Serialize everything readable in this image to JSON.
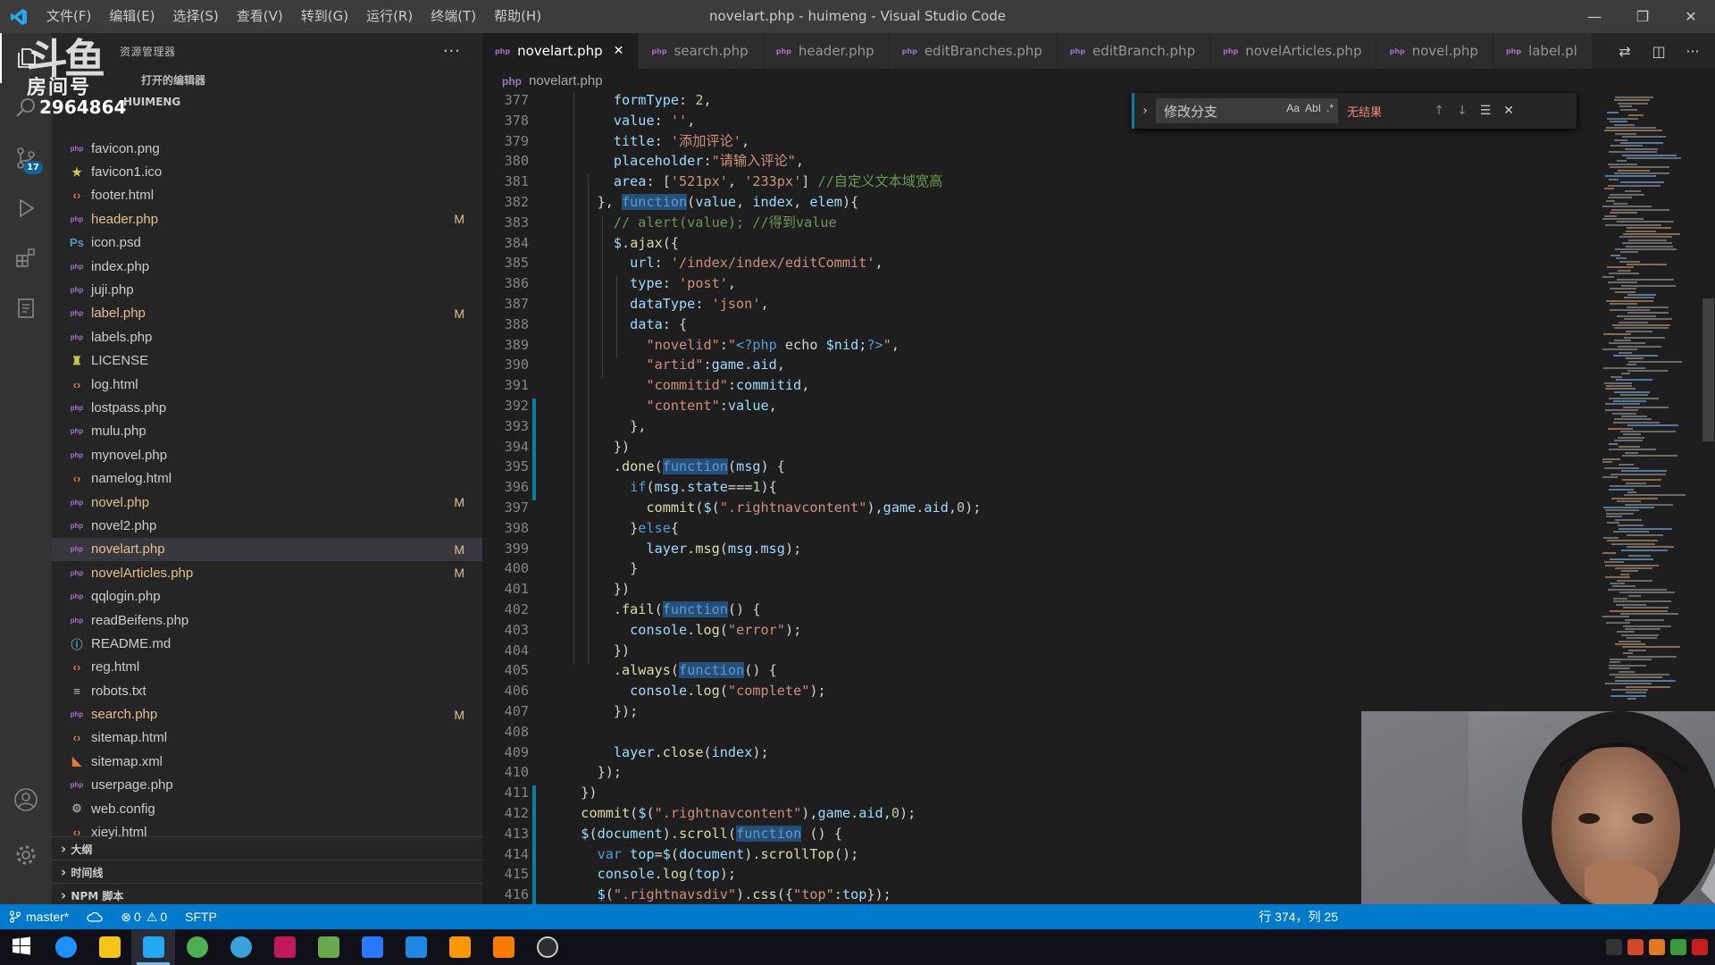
{
  "window": {
    "title": "novelart.php - huimeng - Visual Studio Code",
    "menu": [
      "文件(F)",
      "编辑(E)",
      "选择(S)",
      "查看(V)",
      "转到(G)",
      "运行(R)",
      "终端(T)",
      "帮助(H)"
    ],
    "controls": {
      "minimize": "—",
      "restore": "❐",
      "close": "✕"
    }
  },
  "watermark": {
    "logo": "斗鱼",
    "room": "房间号",
    "number": "2964864"
  },
  "activity_bar": {
    "scm_badge": "17"
  },
  "sidebar": {
    "title": "资源管理器",
    "more": "···",
    "open_editors": "打开的编辑器",
    "folder": "HUIMENG",
    "files": [
      {
        "name": "favicon.png",
        "type": "php",
        "modified": ""
      },
      {
        "name": "favicon1.ico",
        "type": "ico",
        "modified": ""
      },
      {
        "name": "footer.html",
        "type": "html",
        "modified": ""
      },
      {
        "name": "header.php",
        "type": "php",
        "modified": "M"
      },
      {
        "name": "icon.psd",
        "type": "psd",
        "modified": ""
      },
      {
        "name": "index.php",
        "type": "php",
        "modified": ""
      },
      {
        "name": "juji.php",
        "type": "php",
        "modified": ""
      },
      {
        "name": "label.php",
        "type": "php",
        "modified": "M"
      },
      {
        "name": "labels.php",
        "type": "php",
        "modified": ""
      },
      {
        "name": "LICENSE",
        "type": "lic",
        "modified": ""
      },
      {
        "name": "log.html",
        "type": "html",
        "modified": ""
      },
      {
        "name": "lostpass.php",
        "type": "php",
        "modified": ""
      },
      {
        "name": "mulu.php",
        "type": "php",
        "modified": ""
      },
      {
        "name": "mynovel.php",
        "type": "php",
        "modified": ""
      },
      {
        "name": "namelog.html",
        "type": "html",
        "modified": ""
      },
      {
        "name": "novel.php",
        "type": "php",
        "modified": "M"
      },
      {
        "name": "novel2.php",
        "type": "php",
        "modified": ""
      },
      {
        "name": "novelart.php",
        "type": "php",
        "modified": "M"
      },
      {
        "name": "novelArticles.php",
        "type": "php",
        "modified": "M"
      },
      {
        "name": "qqlogin.php",
        "type": "php",
        "modified": ""
      },
      {
        "name": "readBeifens.php",
        "type": "php",
        "modified": ""
      },
      {
        "name": "README.md",
        "type": "info",
        "modified": ""
      },
      {
        "name": "reg.html",
        "type": "html",
        "modified": ""
      },
      {
        "name": "robots.txt",
        "type": "txt",
        "modified": ""
      },
      {
        "name": "search.php",
        "type": "php",
        "modified": "M"
      },
      {
        "name": "sitemap.html",
        "type": "html",
        "modified": ""
      },
      {
        "name": "sitemap.xml",
        "type": "rss",
        "modified": ""
      },
      {
        "name": "userpage.php",
        "type": "php",
        "modified": ""
      },
      {
        "name": "web.config",
        "type": "cfg",
        "modified": ""
      },
      {
        "name": "xieyi.html",
        "type": "html",
        "modified": ""
      }
    ],
    "sections": [
      "大纲",
      "时间线",
      "NPM 脚本"
    ]
  },
  "tabs": [
    {
      "label": "novelart.php",
      "active": true
    },
    {
      "label": "search.php",
      "active": false
    },
    {
      "label": "header.php",
      "active": false
    },
    {
      "label": "editBranches.php",
      "active": false
    },
    {
      "label": "editBranch.php",
      "active": false
    },
    {
      "label": "novelArticles.php",
      "active": false
    },
    {
      "label": "novel.php",
      "active": false
    },
    {
      "label": "label.pl",
      "active": false
    }
  ],
  "breadcrumb": "novelart.php",
  "find": {
    "value": "修改分支",
    "result": "无结果",
    "opt_case": "Aa",
    "opt_word": "AbI",
    "opt_regex": ".*"
  },
  "code": [
    {
      "n": "377",
      "tokens": [
        [
          "p",
          "      "
        ],
        [
          "key",
          "formType"
        ],
        [
          "p",
          ": "
        ],
        [
          "num",
          "2"
        ],
        [
          "p",
          ","
        ]
      ]
    },
    {
      "n": "378",
      "tokens": [
        [
          "p",
          "      "
        ],
        [
          "key",
          "value"
        ],
        [
          "p",
          ": "
        ],
        [
          "str",
          "''"
        ],
        [
          "p",
          ","
        ]
      ]
    },
    {
      "n": "379",
      "tokens": [
        [
          "p",
          "      "
        ],
        [
          "key",
          "title"
        ],
        [
          "p",
          ": "
        ],
        [
          "str",
          "'添加评论'"
        ],
        [
          "p",
          ","
        ]
      ]
    },
    {
      "n": "380",
      "tokens": [
        [
          "p",
          "      "
        ],
        [
          "key",
          "placeholder"
        ],
        [
          "p",
          ":"
        ],
        [
          "str",
          "\"请输入评论\""
        ],
        [
          "p",
          ","
        ]
      ]
    },
    {
      "n": "381",
      "tokens": [
        [
          "p",
          "      "
        ],
        [
          "key",
          "area"
        ],
        [
          "p",
          ": ["
        ],
        [
          "str",
          "'521px'"
        ],
        [
          "p",
          ", "
        ],
        [
          "str",
          "'233px'"
        ],
        [
          "p",
          "] "
        ],
        [
          "cmt",
          "//自定义文本域宽高"
        ]
      ]
    },
    {
      "n": "382",
      "tokens": [
        [
          "p",
          "    }, "
        ],
        [
          "fnhl",
          "function"
        ],
        [
          "p",
          "("
        ],
        [
          "var",
          "value"
        ],
        [
          "p",
          ", "
        ],
        [
          "var",
          "index"
        ],
        [
          "p",
          ", "
        ],
        [
          "var",
          "elem"
        ],
        [
          "p",
          "){"
        ]
      ]
    },
    {
      "n": "383",
      "tokens": [
        [
          "p",
          "      "
        ],
        [
          "cmt",
          "// alert(value); //得到value"
        ]
      ]
    },
    {
      "n": "384",
      "tokens": [
        [
          "p",
          "      "
        ],
        [
          "var",
          "$"
        ],
        [
          "p",
          "."
        ],
        [
          "fn",
          "ajax"
        ],
        [
          "p",
          "({"
        ]
      ]
    },
    {
      "n": "385",
      "tokens": [
        [
          "p",
          "        "
        ],
        [
          "key",
          "url"
        ],
        [
          "p",
          ": "
        ],
        [
          "str",
          "'/index/index/editCommit'"
        ],
        [
          "p",
          ","
        ]
      ]
    },
    {
      "n": "386",
      "tokens": [
        [
          "p",
          "        "
        ],
        [
          "key",
          "type"
        ],
        [
          "p",
          ": "
        ],
        [
          "str",
          "'post'"
        ],
        [
          "p",
          ","
        ]
      ]
    },
    {
      "n": "387",
      "tokens": [
        [
          "p",
          "        "
        ],
        [
          "key",
          "dataType"
        ],
        [
          "p",
          ": "
        ],
        [
          "str",
          "'json'"
        ],
        [
          "p",
          ","
        ]
      ]
    },
    {
      "n": "388",
      "tokens": [
        [
          "p",
          "        "
        ],
        [
          "key",
          "data"
        ],
        [
          "p",
          ": {"
        ]
      ]
    },
    {
      "n": "389",
      "tokens": [
        [
          "p",
          "          "
        ],
        [
          "str",
          "\"novelid\""
        ],
        [
          "p",
          ":"
        ],
        [
          "str",
          "\""
        ],
        [
          "kw",
          "<?php"
        ],
        [
          "p",
          " echo "
        ],
        [
          "var",
          "$nid"
        ],
        [
          "p",
          ";"
        ],
        [
          "kw",
          "?>"
        ],
        [
          "str",
          "\""
        ],
        [
          "p",
          ","
        ]
      ]
    },
    {
      "n": "390",
      "tokens": [
        [
          "p",
          "          "
        ],
        [
          "str",
          "\"artid\""
        ],
        [
          "p",
          ":"
        ],
        [
          "var",
          "game"
        ],
        [
          "p",
          "."
        ],
        [
          "var",
          "aid"
        ],
        [
          "p",
          ","
        ]
      ]
    },
    {
      "n": "391",
      "tokens": [
        [
          "p",
          "          "
        ],
        [
          "str",
          "\"commitid\""
        ],
        [
          "p",
          ":"
        ],
        [
          "var",
          "commitid"
        ],
        [
          "p",
          ","
        ]
      ]
    },
    {
      "n": "392",
      "tokens": [
        [
          "p",
          "          "
        ],
        [
          "str",
          "\"content\""
        ],
        [
          "p",
          ":"
        ],
        [
          "var",
          "value"
        ],
        [
          "p",
          ","
        ]
      ]
    },
    {
      "n": "393",
      "tokens": [
        [
          "p",
          "        },"
        ]
      ]
    },
    {
      "n": "394",
      "tokens": [
        [
          "p",
          "      })"
        ]
      ]
    },
    {
      "n": "395",
      "tokens": [
        [
          "p",
          "      ."
        ],
        [
          "fn",
          "done"
        ],
        [
          "p",
          "("
        ],
        [
          "fnhl",
          "function"
        ],
        [
          "p",
          "("
        ],
        [
          "var",
          "msg"
        ],
        [
          "p",
          ") {"
        ]
      ]
    },
    {
      "n": "396",
      "tokens": [
        [
          "p",
          "        "
        ],
        [
          "kw",
          "if"
        ],
        [
          "p",
          "("
        ],
        [
          "var",
          "msg"
        ],
        [
          "p",
          "."
        ],
        [
          "var",
          "state"
        ],
        [
          "p",
          "==="
        ],
        [
          "num",
          "1"
        ],
        [
          "p",
          "){"
        ]
      ]
    },
    {
      "n": "397",
      "tokens": [
        [
          "p",
          "          "
        ],
        [
          "fn",
          "commit"
        ],
        [
          "p",
          "("
        ],
        [
          "var",
          "$"
        ],
        [
          "p",
          "("
        ],
        [
          "str",
          "\".rightnavcontent\""
        ],
        [
          "p",
          "),"
        ],
        [
          "var",
          "game"
        ],
        [
          "p",
          "."
        ],
        [
          "var",
          "aid"
        ],
        [
          "p",
          ","
        ],
        [
          "num",
          "0"
        ],
        [
          "p",
          ");"
        ]
      ]
    },
    {
      "n": "398",
      "tokens": [
        [
          "p",
          "        }"
        ],
        [
          "kw",
          "else"
        ],
        [
          "p",
          "{"
        ]
      ]
    },
    {
      "n": "399",
      "tokens": [
        [
          "p",
          "          "
        ],
        [
          "var",
          "layer"
        ],
        [
          "p",
          "."
        ],
        [
          "fn",
          "msg"
        ],
        [
          "p",
          "("
        ],
        [
          "var",
          "msg"
        ],
        [
          "p",
          "."
        ],
        [
          "var",
          "msg"
        ],
        [
          "p",
          ");"
        ]
      ]
    },
    {
      "n": "400",
      "tokens": [
        [
          "p",
          "        }"
        ]
      ]
    },
    {
      "n": "401",
      "tokens": [
        [
          "p",
          "      })"
        ]
      ]
    },
    {
      "n": "402",
      "tokens": [
        [
          "p",
          "      ."
        ],
        [
          "fn",
          "fail"
        ],
        [
          "p",
          "("
        ],
        [
          "fnhl",
          "function"
        ],
        [
          "p",
          "() {"
        ]
      ]
    },
    {
      "n": "403",
      "tokens": [
        [
          "p",
          "        "
        ],
        [
          "var",
          "console"
        ],
        [
          "p",
          "."
        ],
        [
          "fn",
          "log"
        ],
        [
          "p",
          "("
        ],
        [
          "str",
          "\"error\""
        ],
        [
          "p",
          ");"
        ]
      ]
    },
    {
      "n": "404",
      "tokens": [
        [
          "p",
          "      })"
        ]
      ]
    },
    {
      "n": "405",
      "tokens": [
        [
          "p",
          "      ."
        ],
        [
          "fn",
          "always"
        ],
        [
          "p",
          "("
        ],
        [
          "fnhl",
          "function"
        ],
        [
          "p",
          "() {"
        ]
      ]
    },
    {
      "n": "406",
      "tokens": [
        [
          "p",
          "        "
        ],
        [
          "var",
          "console"
        ],
        [
          "p",
          "."
        ],
        [
          "fn",
          "log"
        ],
        [
          "p",
          "("
        ],
        [
          "str",
          "\"complete\""
        ],
        [
          "p",
          ");"
        ]
      ]
    },
    {
      "n": "407",
      "tokens": [
        [
          "p",
          "      });"
        ]
      ]
    },
    {
      "n": "408",
      "tokens": [
        [
          "p",
          ""
        ]
      ]
    },
    {
      "n": "409",
      "tokens": [
        [
          "p",
          "      "
        ],
        [
          "var",
          "layer"
        ],
        [
          "p",
          "."
        ],
        [
          "fn",
          "close"
        ],
        [
          "p",
          "("
        ],
        [
          "var",
          "index"
        ],
        [
          "p",
          ");"
        ]
      ]
    },
    {
      "n": "410",
      "tokens": [
        [
          "p",
          "    });"
        ]
      ]
    },
    {
      "n": "411",
      "tokens": [
        [
          "p",
          "  })"
        ]
      ]
    },
    {
      "n": "412",
      "tokens": [
        [
          "p",
          "  "
        ],
        [
          "fn",
          "commit"
        ],
        [
          "p",
          "("
        ],
        [
          "var",
          "$"
        ],
        [
          "p",
          "("
        ],
        [
          "str",
          "\".rightnavcontent\""
        ],
        [
          "p",
          "),"
        ],
        [
          "var",
          "game"
        ],
        [
          "p",
          "."
        ],
        [
          "var",
          "aid"
        ],
        [
          "p",
          ","
        ],
        [
          "num",
          "0"
        ],
        [
          "p",
          ");"
        ]
      ]
    },
    {
      "n": "413",
      "tokens": [
        [
          "p",
          "  "
        ],
        [
          "var",
          "$"
        ],
        [
          "p",
          "("
        ],
        [
          "var",
          "document"
        ],
        [
          "p",
          ")."
        ],
        [
          "fn",
          "scroll"
        ],
        [
          "p",
          "("
        ],
        [
          "fnhl",
          "function"
        ],
        [
          "p",
          " () {"
        ]
      ]
    },
    {
      "n": "414",
      "tokens": [
        [
          "p",
          "    "
        ],
        [
          "kw",
          "var"
        ],
        [
          "p",
          " "
        ],
        [
          "var",
          "top"
        ],
        [
          "p",
          "="
        ],
        [
          "var",
          "$"
        ],
        [
          "p",
          "("
        ],
        [
          "var",
          "document"
        ],
        [
          "p",
          ")."
        ],
        [
          "fn",
          "scrollTop"
        ],
        [
          "p",
          "();"
        ]
      ]
    },
    {
      "n": "415",
      "tokens": [
        [
          "p",
          "    "
        ],
        [
          "var",
          "console"
        ],
        [
          "p",
          "."
        ],
        [
          "fn",
          "log"
        ],
        [
          "p",
          "("
        ],
        [
          "var",
          "top"
        ],
        [
          "p",
          ");"
        ]
      ]
    },
    {
      "n": "416",
      "tokens": [
        [
          "p",
          "    "
        ],
        [
          "var",
          "$"
        ],
        [
          "p",
          "("
        ],
        [
          "str",
          "\".rightnavsdiv\""
        ],
        [
          "p",
          ")."
        ],
        [
          "fn",
          "css"
        ],
        [
          "p",
          "({"
        ],
        [
          "str",
          "\"top\""
        ],
        [
          "p",
          ":"
        ],
        [
          "var",
          "top"
        ],
        [
          "p",
          "});"
        ]
      ]
    }
  ],
  "statusbar": {
    "branch": "master*",
    "errors": "0",
    "warnings": "0",
    "sftp": "SFTP",
    "position": "行 374，列 25"
  },
  "colors": {
    "accent": "#007acc",
    "modified": "#e2c08d",
    "php_icon": "#a074c4"
  },
  "taskbar": {
    "apps": [
      "windows-start",
      "ie",
      "explorer",
      "vscode",
      "chrome",
      "edge",
      "jetbrains",
      "tool",
      "mail",
      "notes",
      "sublime-like",
      "hbuilder",
      "hs"
    ]
  }
}
